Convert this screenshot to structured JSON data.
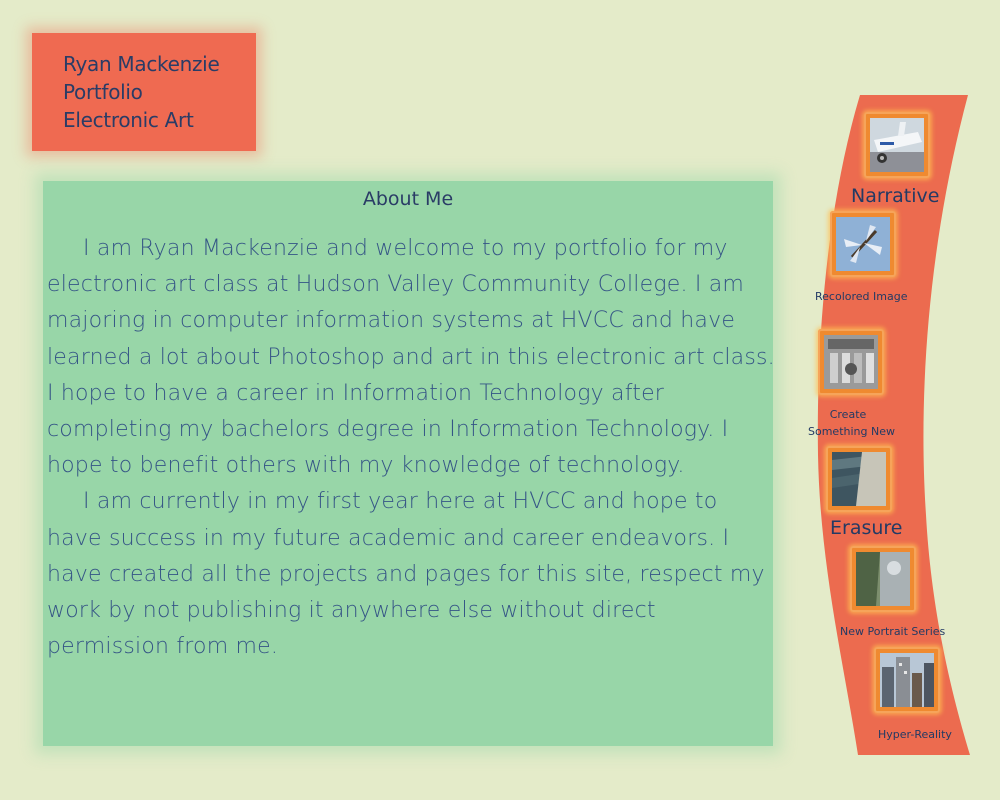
{
  "header": {
    "line1": "Ryan Mackenzie",
    "line2": "Portfolio",
    "line3": "Electronic Art"
  },
  "about": {
    "heading": "About Me",
    "paragraph1": "I am Ryan Mackenzie and welcome to my portfolio for my electronic art class at Hudson Valley Community College. I am majoring in computer information systems at HVCC and have learned a lot about Photoshop and art in this electronic art class. I hope to have a career in Information Technology after completing my bachelors degree in Information Technology. I hope to benefit others with my knowledge of technology.",
    "paragraph2": "I am currently in my first year here at HVCC and hope to have success in my future academic and career endeavors. I have created all the projects and pages for this site, respect my work by not publishing it anywhere else without direct permission from me."
  },
  "nav": {
    "narrative": "Narrative",
    "recolored": "Recolored Image",
    "create_line1": "Create",
    "create_line2": "Something New",
    "erasure": "Erasure",
    "portrait": "New Portrait Series",
    "hyper": "Hyper-Reality"
  },
  "colors": {
    "background": "#e4ebc9",
    "header_box": "#ef6a51",
    "about_panel": "#98d6a8",
    "ribbon": "#ec6b4f",
    "thumb_frame": "#ef8a30",
    "text": "#2a3c66"
  }
}
